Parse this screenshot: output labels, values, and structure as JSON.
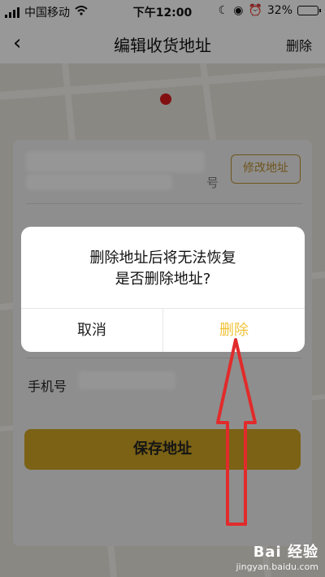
{
  "status_bar": {
    "carrier": "中国移动",
    "time": "下午12:00",
    "battery_percent": "32%",
    "battery_level": 0.32
  },
  "nav": {
    "title": "编辑收货地址",
    "delete_label": "删除",
    "back_icon": "chevron-left-icon"
  },
  "form": {
    "address_suffix": "号",
    "edit_address_label": "修改地址",
    "phone_label": "手机号",
    "save_label": "保存地址"
  },
  "dialog": {
    "message_line1": "删除地址后将无法恢复",
    "message_line2": "是否删除地址?",
    "cancel_label": "取消",
    "confirm_label": "删除"
  },
  "colors": {
    "accent": "#f0c33a",
    "save_button": "#c79f22",
    "arrow": "#e12b2b"
  },
  "watermark": {
    "brand": "Bai 经验",
    "url": "jingyan.baidu.com"
  }
}
